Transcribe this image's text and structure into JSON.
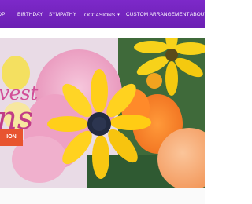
{
  "nav": {
    "items": [
      {
        "label": "OP"
      },
      {
        "label": "BIRTHDAY"
      },
      {
        "label": "SYMPATHY"
      },
      {
        "label": "OCCASIONS"
      },
      {
        "label": "CUSTOM ARRANGEMENT"
      },
      {
        "label": "ABOUT"
      }
    ],
    "occasions_caret": "▾"
  },
  "hero": {
    "headline_line1": "vest",
    "headline_line2": "ns",
    "cta_label": "ION"
  },
  "colors": {
    "nav_bg": "#7d29c9",
    "cta_bg": "#e8542f",
    "headline": "#c13c86"
  }
}
